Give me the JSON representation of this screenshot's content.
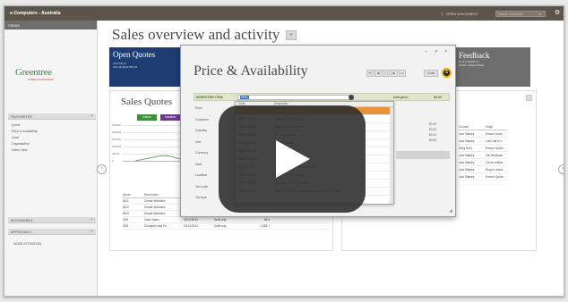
{
  "app": {
    "name": "e-Computers - Australia"
  },
  "topbar": {
    "open_document": "OPEN DOCUMENT",
    "search_placeholder": "Search Greentree"
  },
  "sidebar": {
    "views_label": "VIEWS",
    "logo_text": "Greentree",
    "logo_tagline": "POWER FOR BUSINESS",
    "favourites_label": "FAVOURITES",
    "items": [
      "Quote",
      "Price & Availability",
      "Lead",
      "Organisation",
      "Sales View"
    ],
    "bookmarks_label": "BOOKMARKS",
    "approvals_label": "APPROVALS",
    "mode_attention": "MODE ATTENTION"
  },
  "page": {
    "title": "Sales overview and activity",
    "title_button": "+"
  },
  "tile_quotes": {
    "title_line1": "Open Quotes",
    "subtitle": "ACTIVE  37",
    "value": "VALUE  $264,585.95"
  },
  "tile_feedback": {
    "title": "Feedback",
    "subtitle": "CLICK HERE TO",
    "subtitle2": "EMAIL GREENTREE"
  },
  "sales_quotes": {
    "title": "Sales Quotes",
    "chips": [
      "Active",
      "Inactive"
    ],
    "y_ticks": [
      "250000",
      "200000",
      "150000",
      "100000",
      "50000",
      "0"
    ],
    "table_headers": [
      "Quote",
      "Description",
      "Date",
      "Status",
      "Value"
    ],
    "rows": [
      [
        "IN21",
        "Create Workflow",
        "",
        "",
        ""
      ],
      [
        "IN22",
        "Create Workflow",
        "",
        "",
        ""
      ],
      [
        "IN23",
        "Create Workflow",
        "10/10/2014",
        "Draft only",
        "33,741.2"
      ],
      [
        "I025",
        "Cash Sales",
        "29/10/2014",
        "Draft only",
        "65.5"
      ],
      [
        "I026",
        "Computer and Pe...",
        "10/10/2014",
        "Draft only",
        "1,983.7"
      ]
    ]
  },
  "right_panel": {
    "headers": [
      "Contact",
      "Subje"
    ],
    "rows": [
      [
        "Lisa Stanley",
        "Ensure broch"
      ],
      [
        "Lisa Stanley",
        "Call Lisa to d"
      ],
      [
        "Greg Dent",
        "Ensure Quote"
      ],
      [
        "Lisa Stanley",
        "Get feedback"
      ],
      [
        "Lisa Stanley",
        "Check review"
      ],
      [
        "Lisa Stanley",
        "Ring to check"
      ],
      [
        "Lisa Stanley",
        "Ensure Quote"
      ]
    ]
  },
  "modal": {
    "title": "Price & Availability",
    "window_controls": "– ↗ ×",
    "nav": [
      "⏮",
      "◀",
      "▢",
      "▶",
      "⏭"
    ],
    "close_label": "Close",
    "dollar": "$",
    "inventory_label": "INVENTORY ITEM",
    "inventory_value": "PRO",
    "unit_price_label": "Unit price:",
    "unit_price_value": "$0.00",
    "fields": [
      "Price",
      "Customer",
      "Quantity",
      "Unit",
      "Currency",
      "Date",
      "Location",
      "Tax code",
      "Tax type"
    ],
    "dropdown_headers": [
      "Code",
      "Description"
    ],
    "dropdown_rows": [
      [
        "PRO-00008",
        "Canon 17\" LCD Monitor"
      ],
      [
        "MONITOR-01",
        "Sharp 17\" LCD Monitor"
      ],
      [
        "MONITOR-02",
        "Sharp 19\" LCD Monitor"
      ],
      [
        "MONITOR-03",
        "19\" LCD Monitor"
      ],
      [
        "MONITOR-04",
        "ProView Monitor"
      ],
      [
        "MONITOR-05",
        "22\" Monitor"
      ],
      [
        "MONITOR-06",
        "Canon 17\" LCD Monitor"
      ],
      [
        "MONITOR-07",
        "Sony 17\" LCD Monitor Standard"
      ],
      [
        "MONITOR-08",
        "Sony 17\" LCD Monitor"
      ],
      [
        "MONITOR-09",
        "Samsung 17\" LCD Monitor"
      ],
      [
        "MONITOR-10",
        "Widescreen LCD Digital Monitor with Colour Control"
      ]
    ],
    "right_values": [
      "$0.00",
      "$0.00",
      "$0.00",
      "$0.00"
    ]
  },
  "video": {
    "play_label": "Play video"
  }
}
